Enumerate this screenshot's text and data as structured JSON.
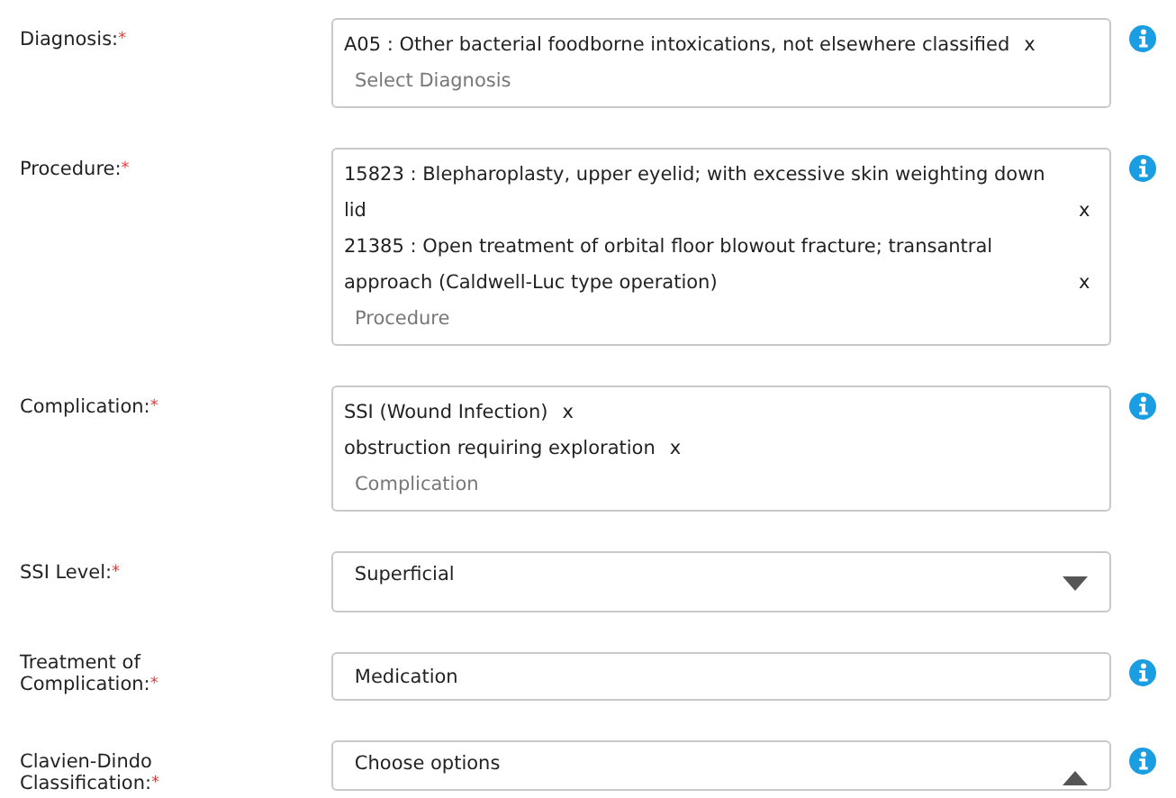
{
  "fields": [
    {
      "kind": "multi",
      "label": "Diagnosis:",
      "required_mark": "*",
      "info": true,
      "tags": [
        {
          "text": "A05 : Other bacterial foodborne intoxications, not elsewhere classified",
          "remove": "x"
        }
      ],
      "placeholder": "Select Diagnosis"
    },
    {
      "kind": "multi",
      "label": "Procedure:",
      "required_mark": "*",
      "info": true,
      "tags": [
        {
          "text": "15823 : Blepharoplasty, upper eyelid; with excessive skin weighting down lid",
          "remove": "x"
        },
        {
          "text": "21385 : Open treatment of orbital floor blowout fracture; transantral approach (Caldwell-Luc type operation)",
          "remove": "x"
        }
      ],
      "placeholder": "Procedure"
    },
    {
      "kind": "multi",
      "label": "Complication:",
      "required_mark": "*",
      "info": true,
      "tags": [
        {
          "text": "SSI (Wound Infection)",
          "remove": "x"
        },
        {
          "text": "obstruction requiring exploration",
          "remove": "x"
        }
      ],
      "placeholder": "Complication"
    },
    {
      "kind": "select",
      "label": "SSI Level:",
      "required_mark": "*",
      "info": false,
      "value": "Superficial",
      "expanded": false
    },
    {
      "kind": "text",
      "label": "Treatment of Complication:",
      "required_mark": "*",
      "info": true,
      "value": "Medication"
    },
    {
      "kind": "select",
      "label": "Clavien-Dindo Classification:",
      "required_mark": "*",
      "info": true,
      "value": "Choose options",
      "expanded": true
    }
  ]
}
